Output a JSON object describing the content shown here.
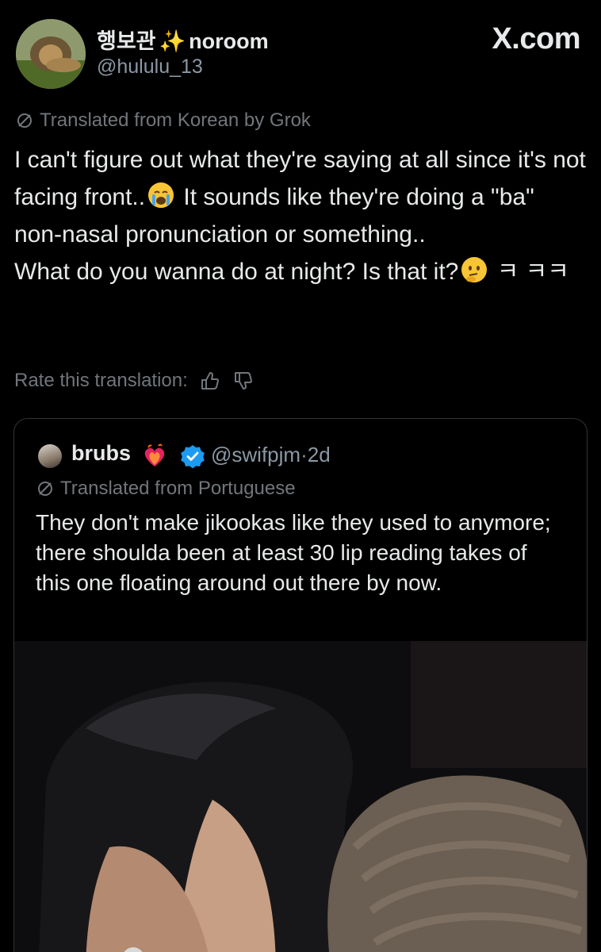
{
  "site_label": "X.com",
  "author": {
    "display_name": "행보관",
    "sparkle": "✨",
    "display_name_suffix": "noroom",
    "handle": "@hululu_13"
  },
  "tweet": {
    "translation_note": "Translated from Korean by Grok",
    "text_line1": "I can't figure out what they're saying at all since it's not facing front..",
    "text_line1b": " It sounds like they're doing a \"ba\" non-nasal pronunciation or something..",
    "text_line2a": "What do you wanna do at night? Is that it?",
    "text_line2b": " ㅋ ㅋㅋ"
  },
  "rate_translation": {
    "label": "Rate this translation:"
  },
  "quoted": {
    "display_name": "brubs",
    "handle": "@swifpjm",
    "separator": "·",
    "time": "2d",
    "translation_note": "Translated from Portuguese",
    "text": "They don't make jikookas like they used to anymore; there shoulda been at least 30 lip reading takes of this one floating around out there by now."
  },
  "colors": {
    "background": "#000000",
    "text_primary": "#e7e9ea",
    "text_secondary": "#71767b",
    "verified_blue": "#1d9bf0",
    "card_border": "#2f3336"
  },
  "icons": [
    "translate-slash-icon",
    "thumbs-up-icon",
    "thumbs-down-icon",
    "verified-badge-icon",
    "heart-fire-emoji-icon",
    "loudly-crying-emoji-icon",
    "thinking-emoji-icon"
  ]
}
